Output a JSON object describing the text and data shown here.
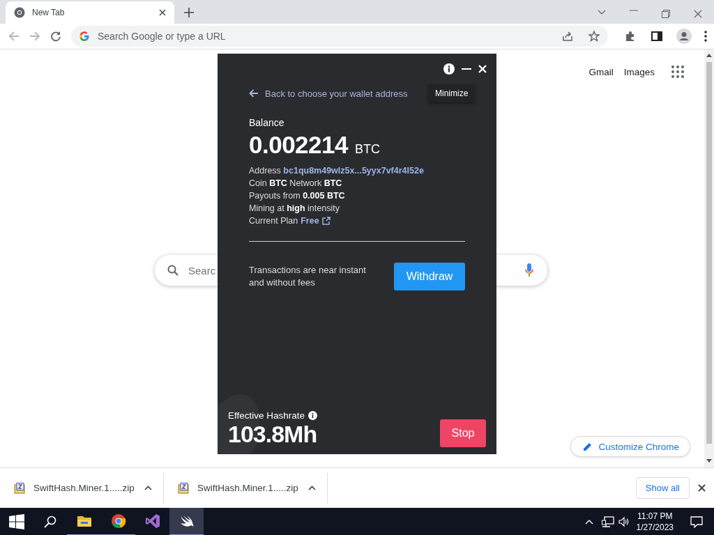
{
  "browser": {
    "tabs": [
      {
        "title": "New Tab",
        "selected": true
      }
    ],
    "omnibox": {
      "placeholder": "Search Google or type a URL"
    }
  },
  "new_tab_page": {
    "header_links": [
      "Gmail",
      "Images"
    ],
    "search": {
      "placeholder": "Searc"
    },
    "customize_button": "Customize Chrome"
  },
  "miner": {
    "tooltip": "Minimize",
    "back_link": "Back to choose your wallet address",
    "balance_label": "Balance",
    "balance": "0.002214",
    "balance_unit": "BTC",
    "details": [
      {
        "kind": "link",
        "label": "Address",
        "value": "bc1qu8m49wlz5x...5yyx7vf4r4l52e"
      },
      {
        "kind": "text",
        "text": "Coin **BTC** Network **BTC**"
      },
      {
        "kind": "text",
        "text": "Payouts from **0.005 BTC**"
      },
      {
        "kind": "text",
        "text": "Mining at **high** intensity"
      },
      {
        "kind": "external_link",
        "label": "Current Plan",
        "value": "Free"
      }
    ],
    "withdraw_note": "Transactions are near instant and without fees",
    "withdraw_button": "Withdraw",
    "hashrate_label": "Effective Hashrate",
    "hashrate": "103.8Mh",
    "stop_button": "Stop"
  },
  "downloads": {
    "items": [
      {
        "name": "SwiftHash.Miner.1.....zip"
      },
      {
        "name": "SwiftHash.Miner.1.....zip"
      }
    ],
    "show_all": "Show all"
  },
  "taskbar": {
    "apps": [
      {
        "running": true,
        "selected": false
      },
      {
        "running": true,
        "selected": false
      },
      {
        "running": false,
        "selected": false
      },
      {
        "running": true,
        "selected": true
      }
    ],
    "clock": {
      "time": "11:07 PM",
      "date": "1/27/2023"
    }
  }
}
